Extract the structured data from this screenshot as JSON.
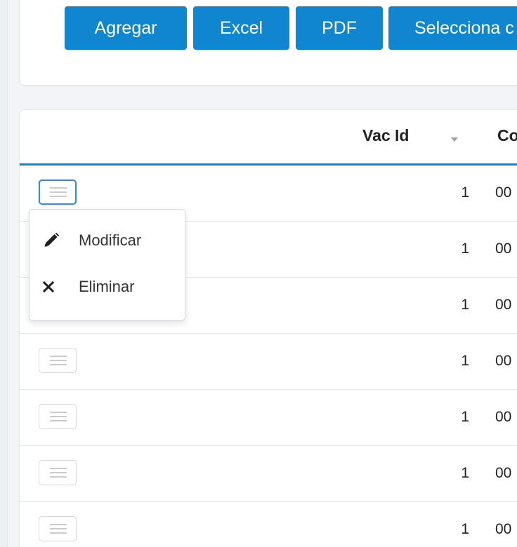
{
  "toolbar": {
    "buttons": [
      {
        "label": "Agregar"
      },
      {
        "label": "Excel"
      },
      {
        "label": "PDF"
      },
      {
        "label": "Selecciona c"
      }
    ]
  },
  "grid": {
    "columns": [
      {
        "label": "Vac Id",
        "sort_icon": "sort-down-icon"
      },
      {
        "label": "Co"
      }
    ],
    "rows": [
      {
        "vac_id": "1",
        "next": "00"
      },
      {
        "vac_id": "1",
        "next": "00"
      },
      {
        "vac_id": "1",
        "next": "00"
      },
      {
        "vac_id": "1",
        "next": "00"
      },
      {
        "vac_id": "1",
        "next": "00"
      },
      {
        "vac_id": "1",
        "next": "00"
      },
      {
        "vac_id": "1",
        "next": "00"
      }
    ]
  },
  "row_menu": {
    "icon": "menu-lines-icon",
    "items": [
      {
        "label": "Modificar",
        "icon": "pencil-icon"
      },
      {
        "label": "Eliminar",
        "icon": "x-icon"
      }
    ]
  },
  "colors": {
    "primary": "#0f86cf",
    "active_border": "#3b8ad9"
  }
}
